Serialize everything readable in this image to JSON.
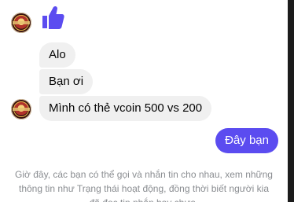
{
  "conversation": {
    "accent_color": "#5b4cf0",
    "like_icon": "thumbs-up-icon",
    "incoming": [
      {
        "text": "Alo"
      },
      {
        "text": "Bạn ơi"
      },
      {
        "text": "Mình có thẻ vcoin 500 vs 200"
      }
    ],
    "outgoing": [
      {
        "text": "Đây bạn"
      }
    ],
    "notice": "Giờ đây, các bạn có thể gọi và nhắn tin cho nhau, xem những thông tin như Trạng thái hoạt động, đồng thời biết người kia đã đọc tin nhắn hay chưa."
  }
}
